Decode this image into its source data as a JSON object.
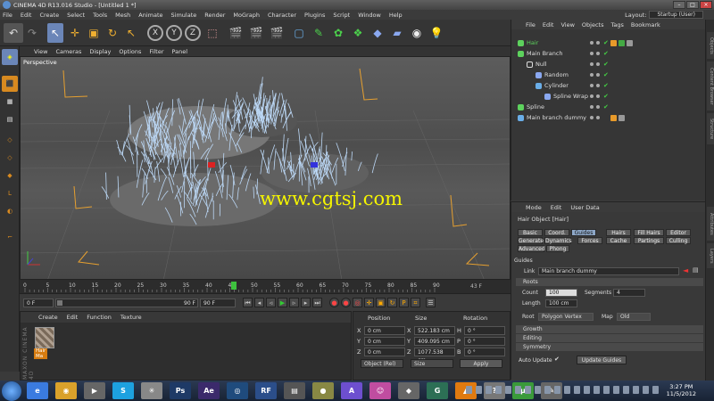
{
  "window": {
    "title": "CINEMA 4D R13.016 Studio - [Untitled 1 *]"
  },
  "menubar": {
    "items": [
      "File",
      "Edit",
      "Create",
      "Select",
      "Tools",
      "Mesh",
      "Animate",
      "Simulate",
      "Render",
      "MoGraph",
      "Character",
      "Plugins",
      "Script",
      "Window",
      "Help"
    ],
    "layout_label": "Layout:",
    "layout_value": "Startup (User)"
  },
  "toolbar": {
    "axis_x": "X",
    "axis_y": "Y",
    "axis_z": "Z"
  },
  "viewport": {
    "menu": [
      "View",
      "Cameras",
      "Display",
      "Options",
      "Filter",
      "Panel"
    ],
    "name": "Perspective",
    "watermark": "www.cgtsj.com"
  },
  "timeline": {
    "ticks": [
      "0",
      "5",
      "10",
      "15",
      "20",
      "25",
      "30",
      "35",
      "40",
      "45",
      "50",
      "55",
      "60",
      "65",
      "70",
      "75",
      "80",
      "85",
      "90"
    ],
    "current": "43 F",
    "end": "43 F"
  },
  "transport": {
    "start": "0 F",
    "current": "0 F",
    "slider_val": "90 F",
    "end": "90 F"
  },
  "materials": {
    "menu": [
      "Create",
      "Edit",
      "Function",
      "Texture"
    ],
    "items": [
      {
        "name": "Hair Ma"
      }
    ],
    "brand": "MAXON CINEMA 4D"
  },
  "coordinates": {
    "headers": [
      "Position",
      "Size",
      "Rotation"
    ],
    "rows": [
      {
        "axis": "X",
        "pos": "0 cm",
        "size_axis": "X",
        "size": "522.183 cm",
        "rot_axis": "H",
        "rot": "0 °"
      },
      {
        "axis": "Y",
        "pos": "0 cm",
        "size_axis": "Y",
        "size": "409.095 cm",
        "rot_axis": "P",
        "rot": "0 °"
      },
      {
        "axis": "Z",
        "pos": "0 cm",
        "size_axis": "Z",
        "size": "1077.538 cm",
        "rot_axis": "B",
        "rot": "0 °"
      }
    ],
    "mode": "Object (Rel)",
    "size_mode": "Size",
    "apply": "Apply"
  },
  "object_manager": {
    "menu": [
      "File",
      "Edit",
      "View",
      "Objects",
      "Tags",
      "Bookmark"
    ],
    "objects": [
      {
        "name": "Hair",
        "color": "#5dd25d",
        "icon": "hair-icon"
      },
      {
        "name": "Main Branch",
        "color": "#cfd8e0",
        "icon": "spline-icon"
      },
      {
        "name": "Null",
        "color": "#cfd8e0",
        "icon": "null-icon"
      },
      {
        "name": "Random",
        "color": "#cfd8e0",
        "icon": "random-icon"
      },
      {
        "name": "Cylinder",
        "color": "#cfd8e0",
        "icon": "cylinder-icon"
      },
      {
        "name": "Spline Wrap",
        "color": "#cfd8e0",
        "icon": "spline-wrap-icon"
      },
      {
        "name": "Spline",
        "color": "#cfd8e0",
        "icon": "spline-icon"
      },
      {
        "name": "Main branch dummy",
        "color": "#cfd8e0",
        "icon": "cube-icon"
      }
    ]
  },
  "attributes": {
    "menu": [
      "Mode",
      "Edit",
      "User Data"
    ],
    "object_title": "Hair Object [Hair]",
    "tabs_row1": [
      "Basic",
      "Coord.",
      "Guides",
      "Hairs",
      "Fill Hairs",
      "Editor"
    ],
    "tabs_row2": [
      "Generate",
      "Dynamics",
      "Forces",
      "Cache",
      "Partings",
      "Culling"
    ],
    "tabs_row3": [
      "Advanced",
      "Phong"
    ],
    "active_tab": "Guides",
    "section": "Guides",
    "link_label": "Link",
    "link_value": "Main branch dummy",
    "roots_section": "Roots",
    "count_label": "Count",
    "count_value": "100",
    "segments_label": "Segments",
    "segments_value": "4",
    "length_label": "Length",
    "length_value": "100 cm",
    "root_label": "Root",
    "root_value": "Polygon Vertex",
    "map_label": "Map",
    "map_value": "Old",
    "growth": "Growth",
    "editing": "Editing",
    "symmetry": "Symmetry",
    "auto_update_label": "Auto Update",
    "update_button": "Update Guides"
  },
  "right_tabs": [
    "Objects",
    "Content Browser",
    "Structure",
    "Attributes",
    "Layers"
  ],
  "taskbar": {
    "apps": [
      {
        "label": "e",
        "color": "#3a7be0"
      },
      {
        "label": "◉",
        "color": "#d9a12b"
      },
      {
        "label": "▶",
        "color": "#666"
      },
      {
        "label": "S",
        "color": "#1da1e0"
      },
      {
        "label": "✳",
        "color": "#888"
      },
      {
        "label": "Ps",
        "color": "#1e3a66"
      },
      {
        "label": "Ae",
        "color": "#3b2a6b"
      },
      {
        "label": "◎",
        "color": "#1f4b7d"
      },
      {
        "label": "RF",
        "color": "#2b4e8a"
      },
      {
        "label": "▤",
        "color": "#555"
      },
      {
        "label": "●",
        "color": "#884"
      },
      {
        "label": "A",
        "color": "#6d4fcf"
      },
      {
        "label": "☺",
        "color": "#c04da0"
      },
      {
        "label": "◆",
        "color": "#666"
      },
      {
        "label": "G",
        "color": "#2c6f55"
      },
      {
        "label": "▲",
        "color": "#e07a10"
      },
      {
        "label": "?",
        "color": "#777"
      },
      {
        "label": "µ",
        "color": "#3a9a3a"
      },
      {
        "label": "✎",
        "color": "#666"
      }
    ],
    "time": "3:27 PM",
    "date": "11/5/2012"
  }
}
